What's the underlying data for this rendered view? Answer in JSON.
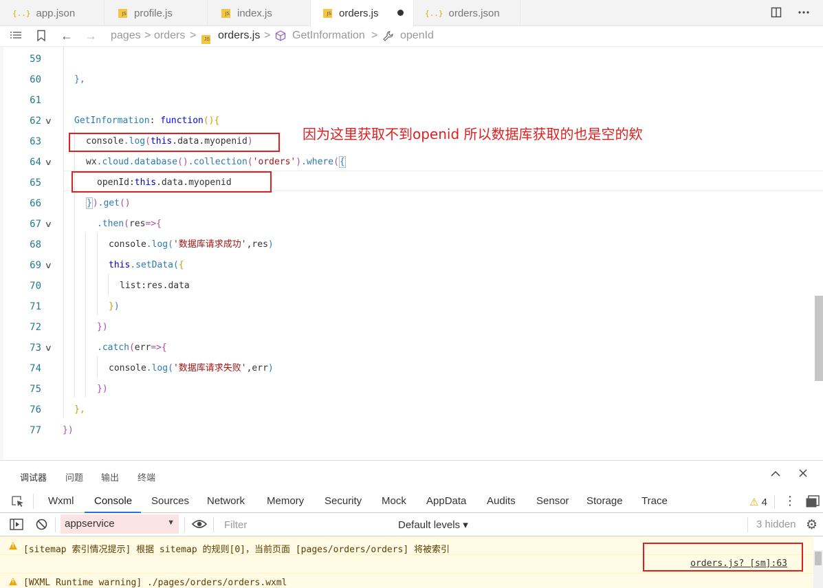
{
  "tabs": [
    {
      "label": "app.json",
      "type": "json",
      "active": false
    },
    {
      "label": "profile.js",
      "type": "js",
      "active": false
    },
    {
      "label": "index.js",
      "type": "js",
      "active": false
    },
    {
      "label": "orders.js",
      "type": "js",
      "active": true,
      "modified": true
    },
    {
      "label": "orders.json",
      "type": "json",
      "active": false
    }
  ],
  "tab_icons": {
    "json": "{..}",
    "js": "JS"
  },
  "breadcrumb": {
    "items": [
      "pages",
      "orders",
      "orders.js",
      "GetInformation",
      "openId"
    ],
    "sep": ">"
  },
  "editor": {
    "lines": [
      59,
      60,
      61,
      62,
      63,
      64,
      65,
      66,
      67,
      68,
      69,
      70,
      71,
      72,
      73,
      74,
      75,
      76,
      77
    ],
    "annotation": "因为这里获取不到openid 所以数据库获取的也是空的欸"
  },
  "code": {
    "l60": "},",
    "l62_name": "GetInformation",
    "l62_rest": ": ",
    "l62_fn": "function",
    "l62_paren": "(){",
    "l63_a": "console",
    "l63_b": ".log",
    "l63_c": "(",
    "l63_d": "this",
    "l63_e": ".data.myopenid",
    "l63_f": ")",
    "l64_a": "wx",
    "l64_b": ".cloud.database",
    "l64_c": "()",
    "l64_d": ".collection",
    "l64_e": "(",
    "l64_f": "'orders'",
    "l64_g": ")",
    "l64_h": ".where",
    "l64_i": "(",
    "l64_j": "{",
    "l65_a": "openId:",
    "l65_b": "this",
    "l65_c": ".data.myopenid",
    "l66_a": "}",
    "l66_b": ")",
    "l66_c": ".get",
    "l66_d": "()",
    "l67_a": ".then",
    "l67_b": "(",
    "l67_c": "res",
    "l67_d": "=>{",
    "l68_a": "console",
    "l68_b": ".log",
    "l68_c": "(",
    "l68_d": "'数据库请求成功'",
    "l68_e": ",res",
    "l68_f": ")",
    "l69_a": "this",
    "l69_b": ".setData",
    "l69_c": "(",
    "l69_d": "{",
    "l70": "list:res.data",
    "l71_a": "}",
    "l71_b": ")",
    "l72": "})",
    "l73_a": ".catch",
    "l73_b": "(",
    "l73_c": "err",
    "l73_d": "=>{",
    "l74_a": "console",
    "l74_b": ".log",
    "l74_c": "(",
    "l74_d": "'数据库请求失败'",
    "l74_e": ",err",
    "l74_f": ")",
    "l75": "})",
    "l76": "},",
    "l77": "})"
  },
  "devtools": {
    "top_tabs": [
      "调试器",
      "问题",
      "输出",
      "终端"
    ],
    "panel_tabs": [
      "Wxml",
      "Console",
      "Sources",
      "Network",
      "Memory",
      "Security",
      "Mock",
      "AppData",
      "Audits",
      "Sensor",
      "Storage",
      "Trace"
    ],
    "active_panel": "Console",
    "warning_count": "4",
    "context": "appservice",
    "filter_placeholder": "Filter",
    "levels": "Default levels ▾",
    "hidden": "3 hidden",
    "messages": [
      {
        "level": "warning",
        "text": "[sitemap 索引情况提示] 根据 sitemap 的规则[0]，当前页面 [pages/orders/orders] 将被索引",
        "source": "orders.js? [sm]:63"
      },
      {
        "level": "warning",
        "text": "[WXML Runtime warning] ./pages/orders/orders.wxml"
      }
    ]
  },
  "colors": {
    "accent": "#1a73e8",
    "annotation": "#e02020",
    "warning_bg": "#fffbe5"
  }
}
